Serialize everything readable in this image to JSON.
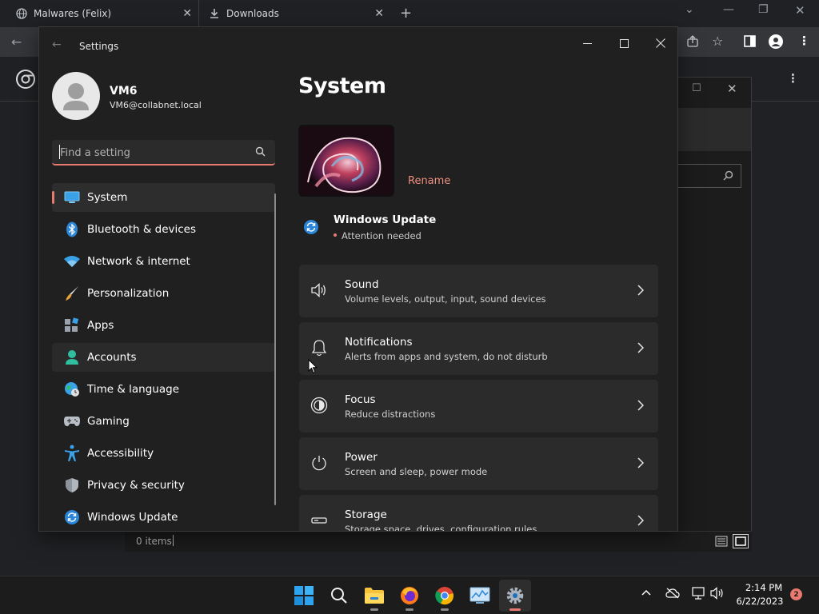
{
  "browser": {
    "tabs": [
      {
        "label": "Malwares (Felix)"
      },
      {
        "label": "Downloads"
      }
    ]
  },
  "file_status": {
    "items_label": "0 items"
  },
  "settings": {
    "window_title": "Settings",
    "user": {
      "name": "VM6",
      "email": "VM6@collabnet.local"
    },
    "search": {
      "placeholder": "Find a setting"
    },
    "nav": [
      {
        "label": "System",
        "icon": "monitor-icon"
      },
      {
        "label": "Bluetooth & devices",
        "icon": "bluetooth-icon"
      },
      {
        "label": "Network & internet",
        "icon": "wifi-icon"
      },
      {
        "label": "Personalization",
        "icon": "paintbrush-icon"
      },
      {
        "label": "Apps",
        "icon": "apps-icon"
      },
      {
        "label": "Accounts",
        "icon": "person-icon"
      },
      {
        "label": "Time & language",
        "icon": "globe-clock-icon"
      },
      {
        "label": "Gaming",
        "icon": "gamepad-icon"
      },
      {
        "label": "Accessibility",
        "icon": "accessibility-icon"
      },
      {
        "label": "Privacy & security",
        "icon": "shield-icon"
      },
      {
        "label": "Windows Update",
        "icon": "sync-icon"
      }
    ],
    "active_nav": "System",
    "page_title": "System",
    "rename_label": "Rename",
    "update": {
      "title": "Windows Update",
      "status": "Attention needed"
    },
    "cards": [
      {
        "title": "Sound",
        "subtitle": "Volume levels, output, input, sound devices",
        "icon": "speaker-icon"
      },
      {
        "title": "Notifications",
        "subtitle": "Alerts from apps and system, do not disturb",
        "icon": "bell-icon"
      },
      {
        "title": "Focus",
        "subtitle": "Reduce distractions",
        "icon": "focus-icon"
      },
      {
        "title": "Power",
        "subtitle": "Screen and sleep, power mode",
        "icon": "power-icon"
      },
      {
        "title": "Storage",
        "subtitle": "Storage space, drives, configuration rules",
        "icon": "storage-icon"
      }
    ],
    "accent_color": "#e97a70"
  },
  "taskbar": {
    "time": "2:14 PM",
    "date": "6/22/2023",
    "notification_count": "2"
  }
}
